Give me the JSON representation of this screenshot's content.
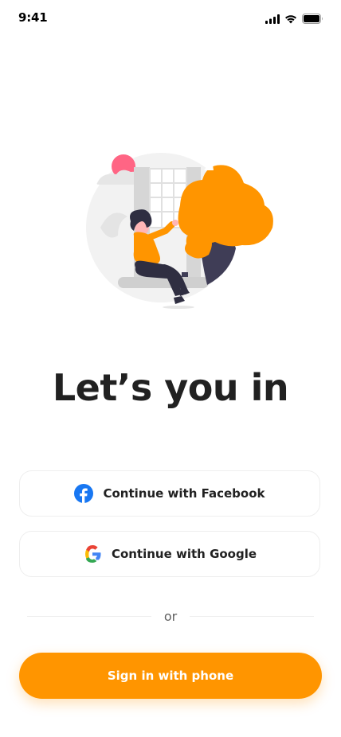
{
  "status_bar": {
    "time": "9:41",
    "icons": [
      "cellular-signal-icon",
      "wifi-icon",
      "battery-icon"
    ]
  },
  "illustration": {
    "name": "woman-reading-by-window-illustration"
  },
  "headline": "Let’s you in",
  "social_buttons": [
    {
      "label": "Continue with Facebook",
      "icon": "facebook-icon"
    },
    {
      "label": "Continue with Google",
      "icon": "google-icon"
    }
  ],
  "divider": {
    "label": "or"
  },
  "primary_button": {
    "label": "Sign in with phone"
  },
  "colors": {
    "accent": "#FF9500",
    "text": "#212121",
    "border": "#EEEEEE",
    "muted": "#616161",
    "facebook": "#1877F2"
  }
}
